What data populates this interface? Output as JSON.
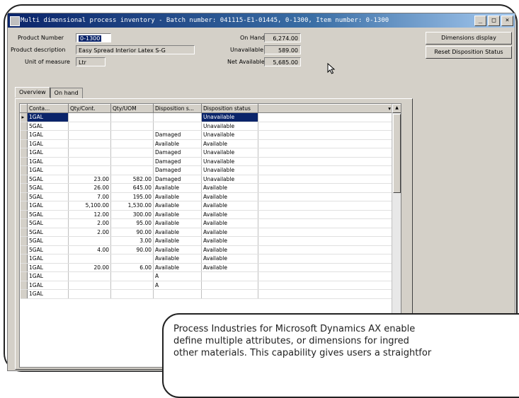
{
  "window": {
    "title": "Multi dimensional process inventory - Batch number: 041115-E1-01445, 0-1300, Item number: 0-1300"
  },
  "form": {
    "product_number_label": "Product Number",
    "product_number_value": "0-1300",
    "product_description_label": "Product description",
    "product_description_value": "Easy Spread Interior Latex S-G",
    "unit_label": "Unit of measure",
    "unit_value": "Ltr",
    "on_hand_label": "On Hand",
    "on_hand_value": "6,274.00",
    "unavailable_label": "Unavailable",
    "unavailable_value": "589.00",
    "net_available_label": "Net Available",
    "net_available_value": "5,685.00"
  },
  "buttons": {
    "dimensions_display": "Dimensions display",
    "reset_disposition": "Reset Disposition Status"
  },
  "tabs": [
    {
      "label": "Overview",
      "active": true
    },
    {
      "label": "On hand",
      "active": false
    }
  ],
  "grid": {
    "columns": [
      "Conta...",
      "Qty/Cont.",
      "Qty/UOM",
      "Disposition s...",
      "Disposition status"
    ],
    "rows": [
      [
        "1GAL",
        "",
        "",
        "",
        "Unavailable"
      ],
      [
        "5GAL",
        "",
        "",
        "",
        "Unavailable"
      ],
      [
        "1GAL",
        "",
        "",
        "Damaged",
        "Unavailable"
      ],
      [
        "1GAL",
        "",
        "",
        "Available",
        "Available"
      ],
      [
        "1GAL",
        "",
        "",
        "Damaged",
        "Unavailable"
      ],
      [
        "1GAL",
        "",
        "",
        "Damaged",
        "Unavailable"
      ],
      [
        "1GAL",
        "",
        "",
        "Damaged",
        "Unavailable"
      ],
      [
        "5GAL",
        "23.00",
        "582.00",
        "Damaged",
        "Unavailable"
      ],
      [
        "5GAL",
        "26.00",
        "645.00",
        "Available",
        "Available"
      ],
      [
        "5GAL",
        "7.00",
        "195.00",
        "Available",
        "Available"
      ],
      [
        "1GAL",
        "5,100.00",
        "1,530.00",
        "Available",
        "Available"
      ],
      [
        "5GAL",
        "12.00",
        "300.00",
        "Available",
        "Available"
      ],
      [
        "5GAL",
        "2.00",
        "95.00",
        "Available",
        "Available"
      ],
      [
        "5GAL",
        "2.00",
        "90.00",
        "Available",
        "Available"
      ],
      [
        "5GAL",
        "",
        "3.00",
        "Available",
        "Available"
      ],
      [
        "5GAL",
        "4.00",
        "90.00",
        "Available",
        "Available"
      ],
      [
        "1GAL",
        "",
        "",
        "Available",
        "Available"
      ],
      [
        "1GAL",
        "20.00",
        "6.00",
        "Available",
        "Available"
      ],
      [
        "1GAL",
        "",
        "",
        "A",
        ""
      ],
      [
        "1GAL",
        "",
        "",
        "A",
        ""
      ],
      [
        "1GAL",
        "",
        "",
        "",
        ""
      ]
    ]
  },
  "callout": {
    "lines": [
      "Process Industries for Microsoft Dynamics AX enable",
      "define multiple attributes, or dimensions for ingred",
      "other materials. This capability gives users a straightfor"
    ]
  },
  "colors": {
    "title_bar": "#0a246a",
    "window_face": "#d4d0c8",
    "selection": "#0a246a"
  }
}
